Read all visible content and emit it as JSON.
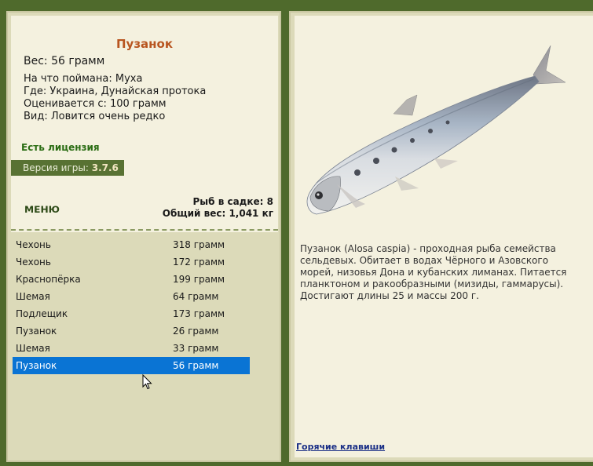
{
  "fish": {
    "name": "Пузанок",
    "weight": "Вес: 56 грамм",
    "caught_with": "На что поймана: Муха",
    "location": "Где: Украина, Дунайская протока",
    "valued_from": "Оценивается с: 100 грамм",
    "rarity": "Вид: Ловится очень редко"
  },
  "license": "Есть лицензия",
  "version": {
    "label": "Версия игры: ",
    "value": "3.7.6"
  },
  "menu_label": "меню",
  "net": {
    "count": "Рыб в садке: 8",
    "total_weight": "Общий вес: 1,041 кг"
  },
  "catch_list": [
    {
      "name": "Чехонь",
      "weight": "318 грамм",
      "selected": false
    },
    {
      "name": "Чехонь",
      "weight": "172 грамм",
      "selected": false
    },
    {
      "name": "Краснопёрка",
      "weight": "199 грамм",
      "selected": false
    },
    {
      "name": "Шемая",
      "weight": "64 грамм",
      "selected": false
    },
    {
      "name": "Подлещик",
      "weight": "173 грамм",
      "selected": false
    },
    {
      "name": "Пузанок",
      "weight": "26 грамм",
      "selected": false
    },
    {
      "name": "Шемая",
      "weight": "33 грамм",
      "selected": false
    },
    {
      "name": "Пузанок",
      "weight": "56 грамм",
      "selected": true
    }
  ],
  "description": "Пузанок (Alosa caspia) - проходная рыба семейства сельдевых. Обитает в водах Чёрного и Азовского морей, низовья Дона и кубанских лиманах. Питается планктоном и ракообразными (мизиды, гаммарусы). Достигают длины 25 и массы 200 г.",
  "hotkeys_label": "Горячие клавиши",
  "colors": {
    "background": "#4f6a2c",
    "title": "#b8551f",
    "license": "#2b6d14",
    "selection": "#0a74d4",
    "link": "#1a2f86"
  }
}
